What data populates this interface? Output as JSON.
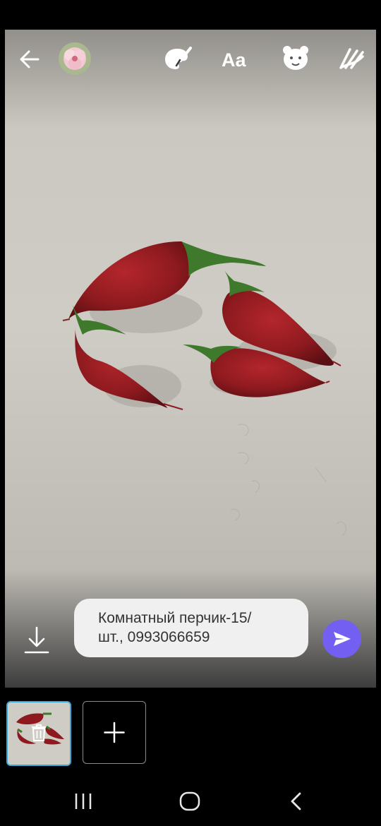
{
  "topbar": {
    "icons": [
      "back-arrow-icon",
      "avatar",
      "paint-brush-icon",
      "text-style-icon",
      "sticker-icon",
      "doodle-icon"
    ],
    "text_tool_label": "Aa"
  },
  "caption": {
    "text_line1": "Комнатный перчик-15/",
    "text_line2": "шт., 0993066659"
  },
  "colors": {
    "accent": "#7360f2",
    "thumb_selected_border": "#3aa7d6",
    "pepper_red": "#8e1a1f",
    "stem_green": "#3f7a2c"
  },
  "thumbnails": {
    "count": 1,
    "selected_index": 0
  }
}
